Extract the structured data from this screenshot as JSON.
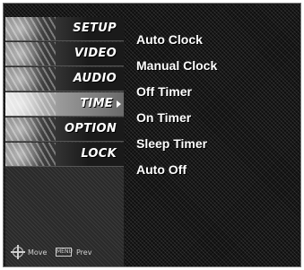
{
  "sidebar": {
    "items": [
      {
        "label": "SETUP",
        "active": false
      },
      {
        "label": "VIDEO",
        "active": false
      },
      {
        "label": "AUDIO",
        "active": false
      },
      {
        "label": "TIME",
        "active": true
      },
      {
        "label": "OPTION",
        "active": false
      },
      {
        "label": "LOCK",
        "active": false
      }
    ]
  },
  "footer": {
    "move_label": "Move",
    "menu_key": "MENU",
    "prev_label": "Prev"
  },
  "submenu": {
    "items": [
      {
        "label": "Auto Clock"
      },
      {
        "label": "Manual Clock"
      },
      {
        "label": "Off Timer"
      },
      {
        "label": "On Timer"
      },
      {
        "label": "Sleep Timer"
      },
      {
        "label": "Auto Off"
      }
    ]
  },
  "icons": {
    "move": "directional-pad-icon",
    "active_indicator": "chevron-right-icon"
  },
  "colors": {
    "background": "#0e0e0e",
    "text": "#ffffff",
    "active_item": "#e8e8e8"
  }
}
